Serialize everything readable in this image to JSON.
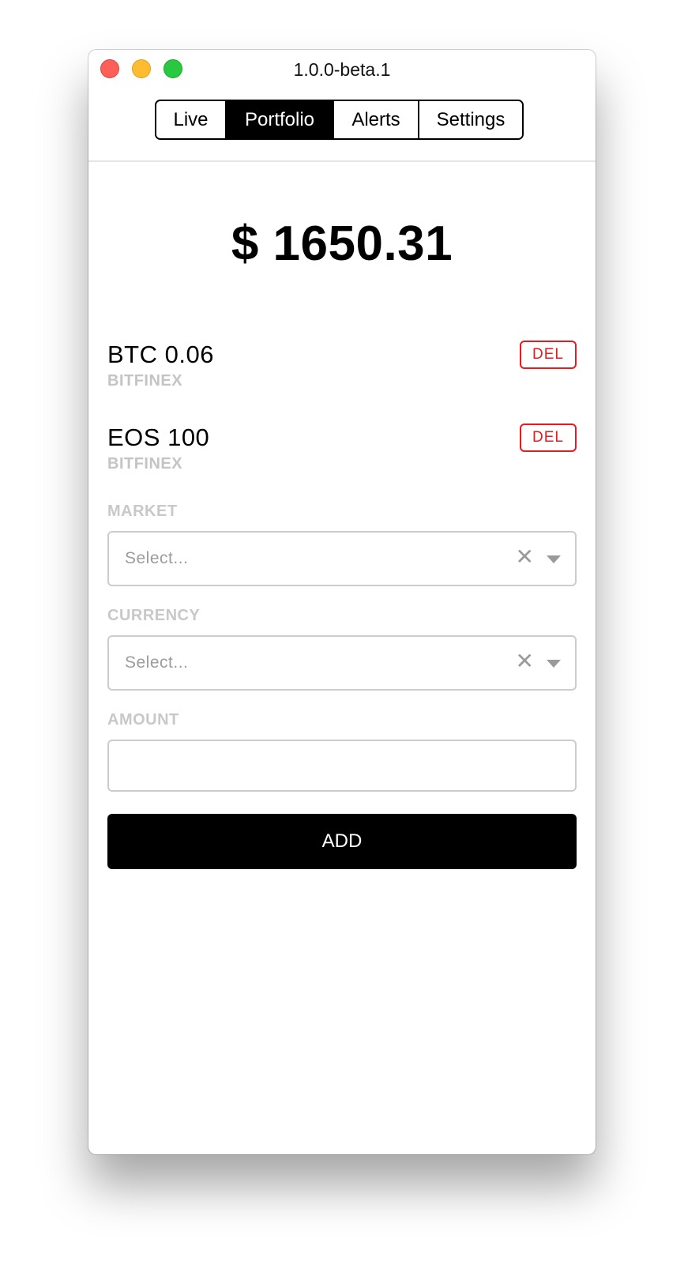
{
  "window": {
    "title": "1.0.0-beta.1"
  },
  "tabs": [
    {
      "label": "Live",
      "active": false
    },
    {
      "label": "Portfolio",
      "active": true
    },
    {
      "label": "Alerts",
      "active": false
    },
    {
      "label": "Settings",
      "active": false
    }
  ],
  "portfolio": {
    "total": "$ 1650.31",
    "holdings": [
      {
        "title": "BTC 0.06",
        "exchange": "BITFINEX",
        "delete_label": "DEL"
      },
      {
        "title": "EOS 100",
        "exchange": "BITFINEX",
        "delete_label": "DEL"
      }
    ]
  },
  "form": {
    "market": {
      "label": "MARKET",
      "placeholder": "Select..."
    },
    "currency": {
      "label": "CURRENCY",
      "placeholder": "Select..."
    },
    "amount": {
      "label": "AMOUNT",
      "value": ""
    },
    "add_label": "ADD"
  },
  "colors": {
    "accent": "#000000",
    "delete": "#e8191f",
    "muted": "#c4c4c4"
  },
  "icons": {
    "clear": "close-icon",
    "dropdown": "caret-down-icon"
  }
}
